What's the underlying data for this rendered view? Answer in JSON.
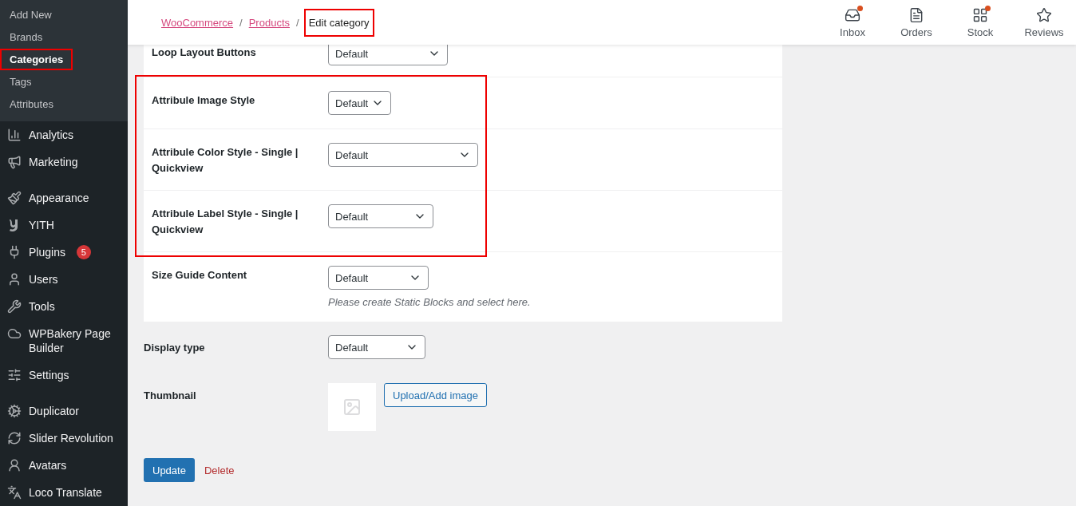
{
  "sidebar": {
    "submenu": [
      {
        "label": "Add New",
        "selected": false,
        "highlighted": false
      },
      {
        "label": "Brands",
        "selected": false,
        "highlighted": false
      },
      {
        "label": "Categories",
        "selected": true,
        "highlighted": true
      },
      {
        "label": "Tags",
        "selected": false,
        "highlighted": false
      },
      {
        "label": "Attributes",
        "selected": false,
        "highlighted": false
      }
    ],
    "menu_groups": [
      [
        {
          "kind": "analytics",
          "label": "Analytics"
        },
        {
          "kind": "marketing",
          "label": "Marketing"
        }
      ],
      [
        {
          "kind": "appearance",
          "label": "Appearance"
        },
        {
          "kind": "yith",
          "label": "YITH"
        },
        {
          "kind": "plugins",
          "label": "Plugins",
          "badge": "5"
        },
        {
          "kind": "users",
          "label": "Users"
        },
        {
          "kind": "tools",
          "label": "Tools"
        },
        {
          "kind": "builder",
          "label": "WPBakery Page Builder"
        },
        {
          "kind": "settings",
          "label": "Settings"
        }
      ],
      [
        {
          "kind": "duplicator",
          "label": "Duplicator"
        },
        {
          "kind": "slider",
          "label": "Slider Revolution"
        },
        {
          "kind": "avatars",
          "label": "Avatars"
        },
        {
          "kind": "translate",
          "label": "Loco Translate"
        }
      ]
    ]
  },
  "header": {
    "separator": "/",
    "breadcrumbs": [
      {
        "label": "WooCommerce",
        "current": false,
        "highlighted": false
      },
      {
        "label": "Products",
        "current": false,
        "highlighted": false
      },
      {
        "label": "Edit category",
        "current": true,
        "highlighted": true
      }
    ],
    "activity": [
      {
        "kind": "inbox",
        "label": "Inbox",
        "unread": true
      },
      {
        "kind": "orders",
        "label": "Orders",
        "unread": false
      },
      {
        "kind": "stock",
        "label": "Stock",
        "unread": true
      },
      {
        "kind": "reviews",
        "label": "Reviews",
        "unread": false
      }
    ]
  },
  "panel_fields": [
    {
      "label": "Loop Layout Buttons",
      "value": "Default",
      "highlighted": false
    },
    {
      "label": "Attribule Image Style",
      "value": "Default",
      "highlighted": true
    },
    {
      "label": "Attribule Color Style - Single | Quickview",
      "value": "Default",
      "highlighted": true
    },
    {
      "label": "Attribule Label Style - Single | Quickview",
      "value": "Default",
      "highlighted": true
    },
    {
      "label": "Size Guide Content",
      "value": "Default",
      "highlighted": false,
      "description": "Please create Static Blocks and select here."
    }
  ],
  "display_type": {
    "label": "Display type",
    "value": "Default"
  },
  "thumbnail": {
    "label": "Thumbnail",
    "button": "Upload/Add image"
  },
  "actions": {
    "primary": "Update",
    "delete": "Delete"
  }
}
